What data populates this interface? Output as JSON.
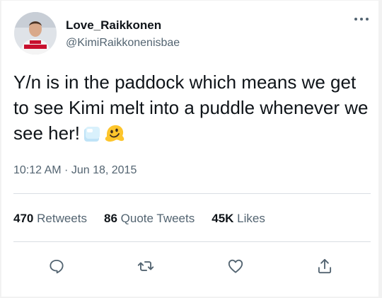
{
  "tweet": {
    "author_name": "Love_Raikkonen",
    "author_handle": "@KimiRaikkonenisbae",
    "text": "Y/n is in the paddock which means we get to see Kimi melt into a puddle whenever we see her!",
    "emojis": [
      "ice-cube-emoji",
      "melting-face-emoji"
    ],
    "timestamp": "10:12 AM · Jun 18, 2015"
  },
  "stats": {
    "retweets_count": "470",
    "retweets_label": "Retweets",
    "quotes_count": "86",
    "quotes_label": "Quote Tweets",
    "likes_count": "45K",
    "likes_label": "Likes"
  },
  "actions": [
    "reply-icon",
    "retweet-icon",
    "like-icon",
    "share-icon"
  ],
  "colors": {
    "primary_text": "#0f1419",
    "secondary_text": "#536471",
    "divider": "#d9dee3",
    "background": "#ffffff"
  }
}
